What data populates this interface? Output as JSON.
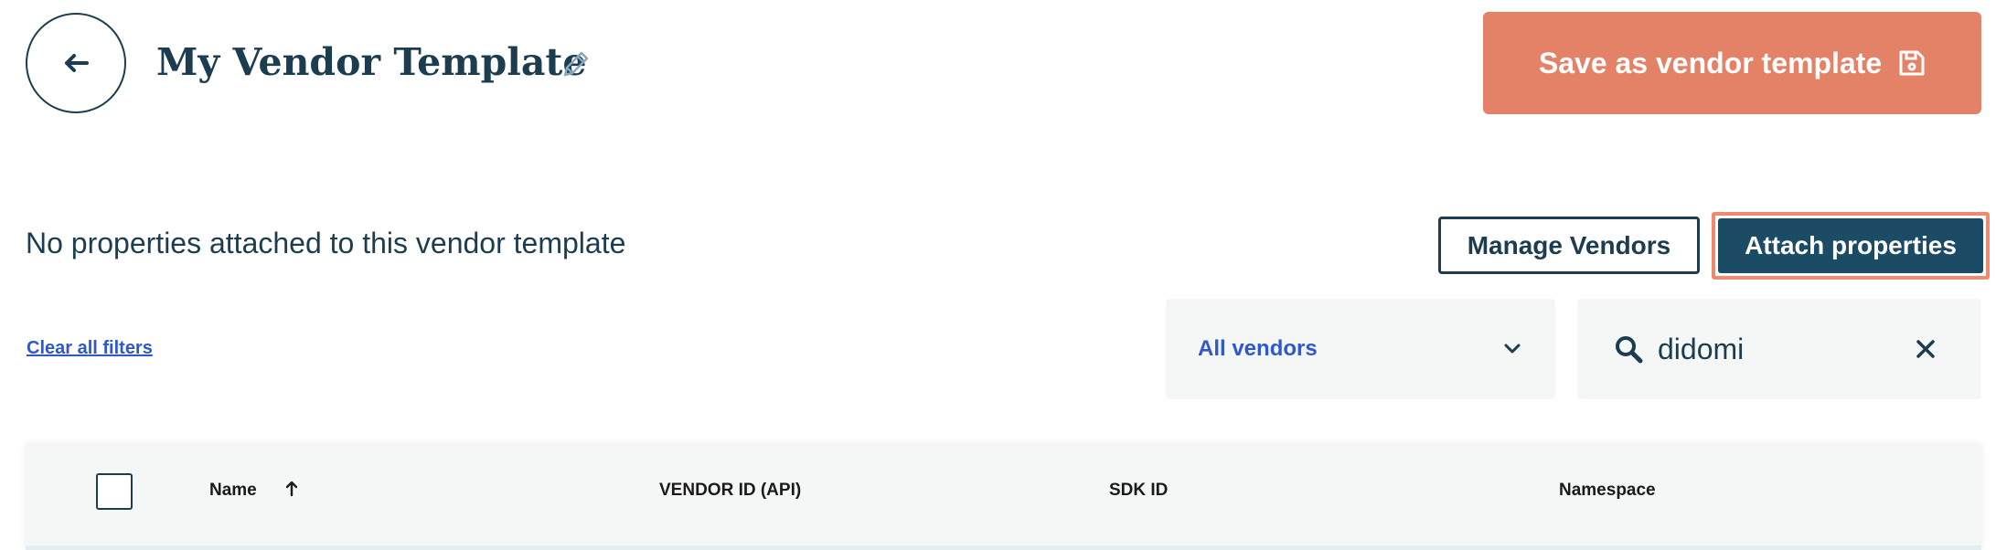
{
  "header": {
    "title": "My Vendor Template",
    "save_label": "Save as vendor template"
  },
  "status_message": "No properties attached to this vendor template",
  "actions": {
    "manage_label": "Manage Vendors",
    "attach_label": "Attach properties"
  },
  "filters": {
    "clear_label": "Clear all filters",
    "vendor_select_value": "All vendors",
    "search_value": "didomi"
  },
  "table": {
    "columns": [
      "Name",
      "VENDOR ID (API)",
      "SDK ID",
      "Namespace"
    ],
    "sort_column": "Name",
    "sort_direction": "ascending"
  },
  "colors": {
    "primary_dark": "#1c3d50",
    "save_button": "#e38266",
    "attach_button": "#1c4b65",
    "attach_highlight": "#f08a6e",
    "link": "#2f57cf",
    "panel_bg": "#f5f7f7"
  }
}
